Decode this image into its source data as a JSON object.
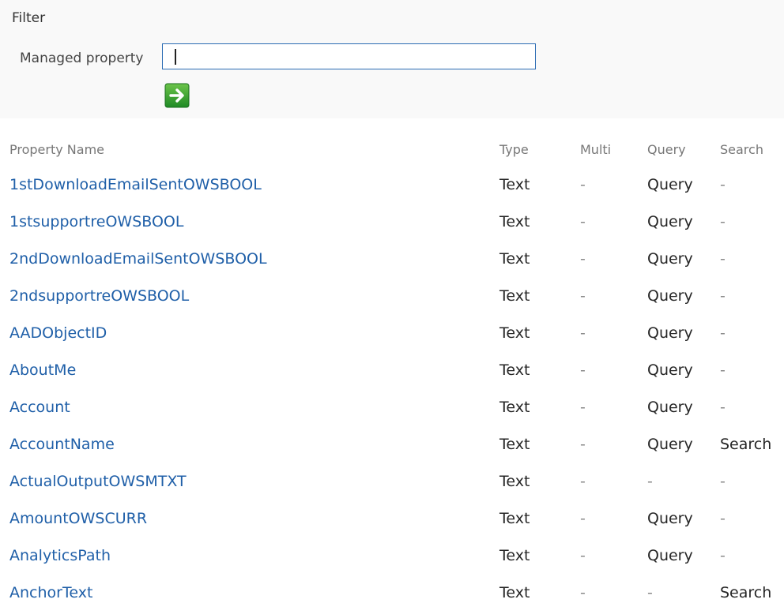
{
  "filter": {
    "title": "Filter",
    "label": "Managed property",
    "value": "",
    "placeholder": "",
    "go_icon": "green-arrow-right-icon",
    "go_color": "#2e9b2e"
  },
  "columns": {
    "name": "Property Name",
    "type": "Type",
    "multi": "Multi",
    "query": "Query",
    "search": "Search"
  },
  "rows": [
    {
      "name": "1stDownloadEmailSentOWSBOOL",
      "type": "Text",
      "multi": "-",
      "query": "Query",
      "search": "-"
    },
    {
      "name": "1stsupportreOWSBOOL",
      "type": "Text",
      "multi": "-",
      "query": "Query",
      "search": "-"
    },
    {
      "name": "2ndDownloadEmailSentOWSBOOL",
      "type": "Text",
      "multi": "-",
      "query": "Query",
      "search": "-"
    },
    {
      "name": "2ndsupportreOWSBOOL",
      "type": "Text",
      "multi": "-",
      "query": "Query",
      "search": "-"
    },
    {
      "name": "AADObjectID",
      "type": "Text",
      "multi": "-",
      "query": "Query",
      "search": "-"
    },
    {
      "name": "AboutMe",
      "type": "Text",
      "multi": "-",
      "query": "Query",
      "search": "-"
    },
    {
      "name": "Account",
      "type": "Text",
      "multi": "-",
      "query": "Query",
      "search": "-"
    },
    {
      "name": "AccountName",
      "type": "Text",
      "multi": "-",
      "query": "Query",
      "search": "Search"
    },
    {
      "name": "ActualOutputOWSMTXT",
      "type": "Text",
      "multi": "-",
      "query": "-",
      "search": "-"
    },
    {
      "name": "AmountOWSCURR",
      "type": "Text",
      "multi": "-",
      "query": "Query",
      "search": "-"
    },
    {
      "name": "AnalyticsPath",
      "type": "Text",
      "multi": "-",
      "query": "Query",
      "search": "-"
    },
    {
      "name": "AnchorText",
      "type": "Text",
      "multi": "-",
      "query": "-",
      "search": "Search"
    }
  ],
  "colors": {
    "link": "#1f5fa8",
    "input_border": "#2a6bb3",
    "header_text": "#777777"
  }
}
